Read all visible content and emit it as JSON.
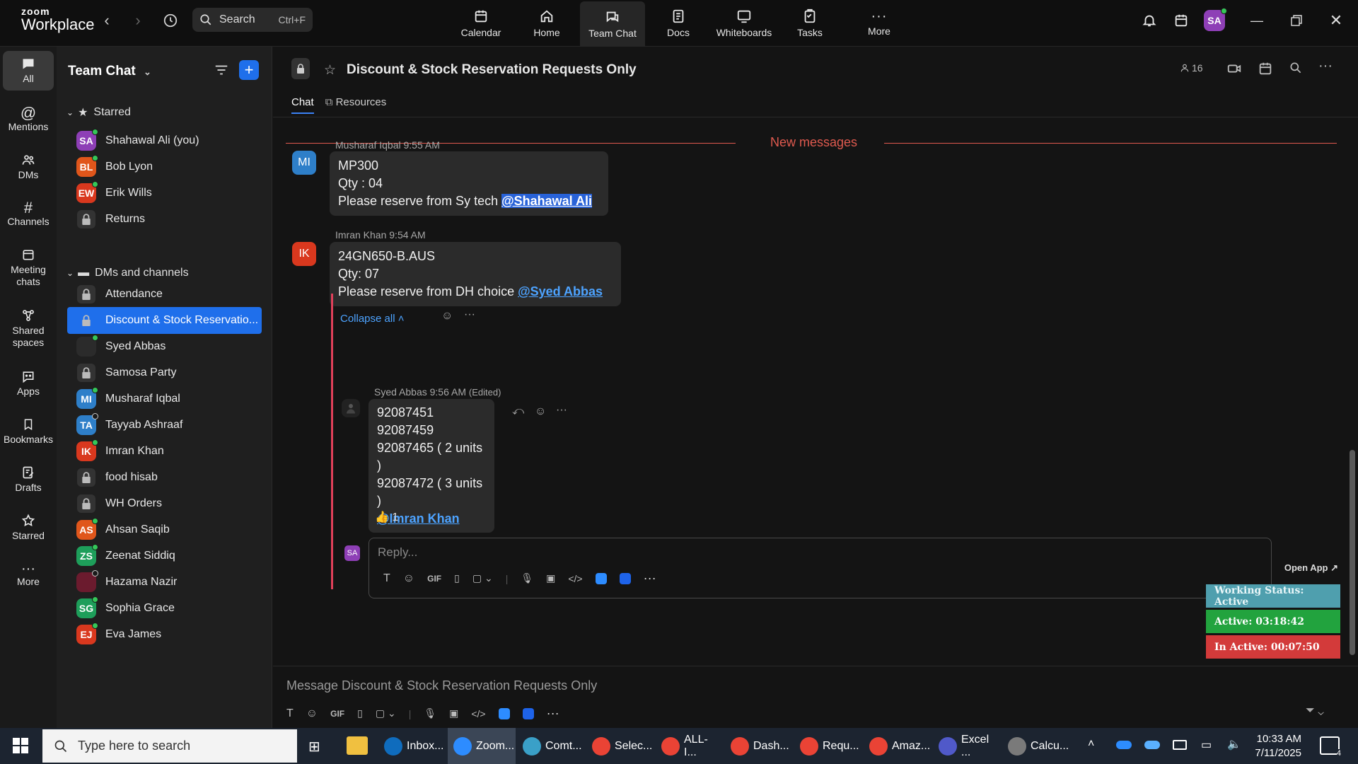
{
  "app": {
    "brand_top": "zoom",
    "brand_bottom": "Workplace"
  },
  "search": {
    "label": "Search",
    "shortcut": "Ctrl+F"
  },
  "topnav": [
    {
      "label": "Calendar",
      "icon": "calendar-icon"
    },
    {
      "label": "Home",
      "icon": "home-icon"
    },
    {
      "label": "Team Chat",
      "icon": "chat-icon",
      "active": true
    },
    {
      "label": "Docs",
      "icon": "docs-icon"
    },
    {
      "label": "Whiteboards",
      "icon": "whiteboard-icon"
    },
    {
      "label": "Tasks",
      "icon": "tasks-icon"
    },
    {
      "label": "More",
      "icon": "more-icon"
    }
  ],
  "user": {
    "initials": "SA",
    "color": "#8e3fb6"
  },
  "rail": [
    {
      "label": "All",
      "active": true
    },
    {
      "label": "Mentions"
    },
    {
      "label": "DMs"
    },
    {
      "label": "Channels"
    },
    {
      "label": "Meeting chats"
    },
    {
      "label": "Shared spaces"
    },
    {
      "label": "Apps"
    },
    {
      "label": "Bookmarks"
    },
    {
      "label": "Drafts"
    },
    {
      "label": "Starred"
    },
    {
      "label": "More"
    }
  ],
  "sidebar": {
    "title": "Team Chat",
    "starred_label": "Starred",
    "dms_label": "DMs and channels",
    "starred": [
      {
        "name": "Shahawal Ali (you)",
        "initials": "SA",
        "color": "#8e3fb6",
        "status": "online"
      },
      {
        "name": "Bob Lyon",
        "initials": "BL",
        "color": "#e0561b",
        "status": "online"
      },
      {
        "name": "Erik Wills",
        "initials": "EW",
        "color": "#d9381e",
        "status": "online"
      },
      {
        "name": "Returns",
        "type": "channel"
      }
    ],
    "channels": [
      {
        "name": "Attendance",
        "type": "channel"
      },
      {
        "name": "Discount & Stock Reservatio...",
        "type": "channel",
        "active": true
      },
      {
        "name": "Syed Abbas",
        "initials": "",
        "color": "#2b2b2b",
        "status": "online"
      },
      {
        "name": "Samosa Party",
        "type": "channel"
      },
      {
        "name": "Musharaf Iqbal",
        "initials": "MI",
        "color": "#2e7fc9",
        "status": "online"
      },
      {
        "name": "Tayyab Ashraaf",
        "initials": "TA",
        "color": "#2e7fc9",
        "status": "away"
      },
      {
        "name": "Imran Khan",
        "initials": "IK",
        "color": "#d9381e",
        "status": "online"
      },
      {
        "name": "food hisab",
        "type": "channel"
      },
      {
        "name": "WH Orders",
        "type": "channel"
      },
      {
        "name": "Ahsan Saqib",
        "initials": "AS",
        "color": "#e0561b",
        "status": "online"
      },
      {
        "name": "Zeenat Siddiq",
        "initials": "ZS",
        "color": "#1e9e5a",
        "status": "online"
      },
      {
        "name": "Hazama Nazir",
        "initials": "",
        "color": "#6b1b2e",
        "status": "away"
      },
      {
        "name": "Sophia Grace",
        "initials": "SG",
        "color": "#1e9e5a",
        "status": "online"
      },
      {
        "name": "Eva James",
        "initials": "EJ",
        "color": "#d9381e",
        "status": "online"
      }
    ]
  },
  "channel": {
    "title": "Discount & Stock Reservation Requests Only",
    "member_count": "16",
    "tabs": [
      "Chat",
      "Resources"
    ]
  },
  "messages": {
    "new_label": "New messages",
    "m1": {
      "initials": "MI",
      "color": "#2e7fc9",
      "sender": "Musharaf Iqbal",
      "time": "9:55 AM",
      "line1": "MP300",
      "line2": "Qty : 04",
      "line3": "Please reserve from Sy tech ",
      "mention": "@Shahawal Ali"
    },
    "m2": {
      "initials": "IK",
      "color": "#d9381e",
      "sender": "Imran Khan",
      "time": "9:54 AM",
      "line1": "24GN650-B.AUS",
      "line2": "Qty: 07",
      "line3": "Please reserve from DH choice ",
      "mention": "@Syed Abbas"
    },
    "collapse": "Collapse all",
    "reply": {
      "sender": "Syed Abbas",
      "time": "9:56 AM",
      "edited": "(Edited)",
      "lines": [
        "92087451",
        "92087459",
        "92087465 ( 2 units )",
        "92087472 ( 3 units )"
      ],
      "mention": "@Imran Khan",
      "reaction": "👍",
      "reaction_count": "1"
    },
    "reply_placeholder": "Reply...",
    "composer_placeholder": "Message Discount & Stock Reservation Requests Only"
  },
  "widget": {
    "open_app": "Open App ↗",
    "status": "Working Status: Active",
    "active": "Active: 03:18:42",
    "inactive": "In Active: 00:07:50"
  },
  "taskbar": {
    "search_placeholder": "Type here to search",
    "apps": [
      {
        "label": "Inbox...",
        "color": "#0f6cbd"
      },
      {
        "label": "Zoom...",
        "color": "#2d8cff",
        "active": true
      },
      {
        "label": "Comt...",
        "color": "#3aa0c8"
      },
      {
        "label": "Selec...",
        "color": "#ea4335"
      },
      {
        "label": "ALL-I...",
        "color": "#ea4335"
      },
      {
        "label": "Dash...",
        "color": "#ea4335"
      },
      {
        "label": "Requ...",
        "color": "#ea4335"
      },
      {
        "label": "Amaz...",
        "color": "#ea4335"
      },
      {
        "label": "Excel ...",
        "color": "#5059c9"
      },
      {
        "label": "Calcu...",
        "color": "#7a7a7a"
      }
    ],
    "time": "10:33 AM",
    "date": "7/11/2025",
    "notif_count": "4"
  }
}
